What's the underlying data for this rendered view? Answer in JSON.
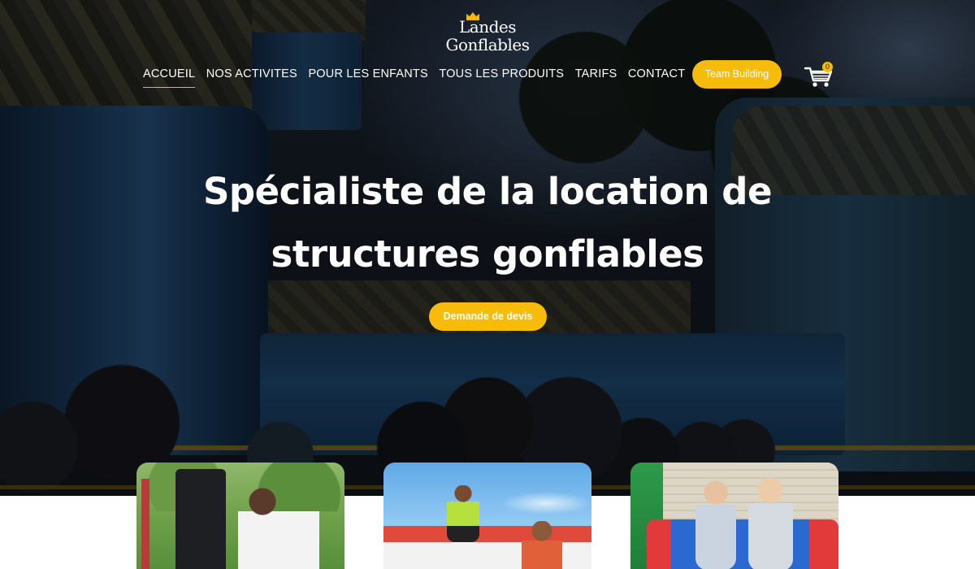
{
  "logo": {
    "line1": "Landes",
    "line2": "Gonflables",
    "crown_color": "#f5b800"
  },
  "nav": {
    "items": [
      {
        "label": "ACCUEIL",
        "active": true
      },
      {
        "label": "NOS ACTIVITES",
        "active": false
      },
      {
        "label": "POUR LES ENFANTS",
        "active": false
      },
      {
        "label": "TOUS LES PRODUITS",
        "active": false
      },
      {
        "label": "TARIFS",
        "active": false
      },
      {
        "label": "CONTACT",
        "active": false
      }
    ],
    "team_building_label": "Team Building",
    "cart_count": "0",
    "cart_icon": "shopping-cart-icon"
  },
  "hero": {
    "title_line1": "Spécialiste de la location de",
    "title_line2": "structures gonflables",
    "cta_label": "Demande de devis"
  },
  "cards": [
    {
      "name": "card-team-activity"
    },
    {
      "name": "card-inflatable-game"
    },
    {
      "name": "card-kids-slide"
    }
  ],
  "colors": {
    "accent": "#f7bb09",
    "text_light": "#ffffff"
  }
}
